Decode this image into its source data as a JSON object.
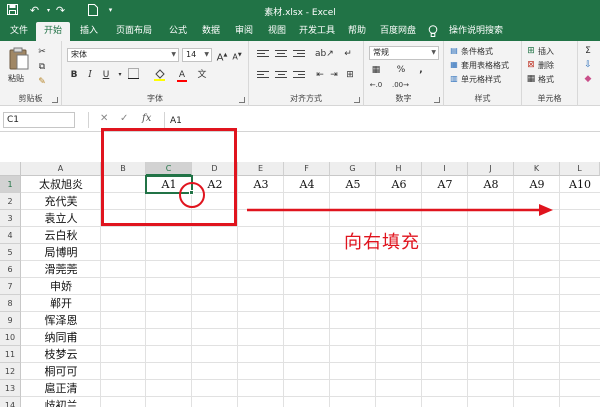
{
  "window": {
    "title": "素材.xlsx - Excel"
  },
  "qat": {
    "icons": [
      "save-icon",
      "undo-icon",
      "redo-icon",
      "new-document-icon",
      "customize-icon"
    ]
  },
  "tabs": [
    {
      "label": "文件"
    },
    {
      "label": "开始"
    },
    {
      "label": "插入"
    },
    {
      "label": "页面布局"
    },
    {
      "label": "公式"
    },
    {
      "label": "数据"
    },
    {
      "label": "审阅"
    },
    {
      "label": "视图"
    },
    {
      "label": "开发工具"
    },
    {
      "label": "帮助"
    },
    {
      "label": "百度网盘"
    },
    {
      "label": "操作说明搜索"
    }
  ],
  "active_tab": "开始",
  "ribbon": {
    "clipboard": {
      "paste_label": "粘贴",
      "group_label": "剪贴板"
    },
    "font": {
      "font_name": "宋体",
      "font_size": "14",
      "group_label": "字体"
    },
    "alignment": {
      "group_label": "对齐方式"
    },
    "number": {
      "format": "常规",
      "percent": "%",
      "comma": ",",
      "group_label": "数字"
    },
    "styles": {
      "conditional": "条件格式",
      "table": "套用表格格式",
      "cell_styles": "单元格样式",
      "group_label": "样式"
    },
    "cells": {
      "insert": "插入",
      "delete": "删除",
      "format": "格式",
      "group_label": "单元格"
    }
  },
  "formula_bar": {
    "name_box": "C1",
    "formula": "A1",
    "fx": "fx"
  },
  "sheet": {
    "columns": [
      "A",
      "B",
      "C",
      "D",
      "E",
      "F",
      "G",
      "H",
      "I",
      "J",
      "K",
      "L"
    ],
    "rows": [
      "1",
      "2",
      "3",
      "4",
      "5",
      "6",
      "7",
      "8",
      "9",
      "10",
      "11",
      "12",
      "13",
      "14"
    ],
    "col_a": [
      "太叔旭炎",
      "充代芙",
      "袁立人",
      "云白秋",
      "局博明",
      "滑莞莞",
      "申娇",
      "郸开",
      "恽泽恩",
      "纳同甫",
      "枝梦云",
      "桐可可",
      "扈正清",
      "歧初兰"
    ],
    "row1": [
      "A1",
      "A2",
      "A3",
      "A4",
      "A5",
      "A6",
      "A7",
      "A8",
      "A9",
      "A10"
    ],
    "active_cell": "C1"
  },
  "annotation": {
    "text": "向右填充",
    "color": "#e0141e"
  },
  "colors": {
    "excel_green": "#217346",
    "ribbon_bg": "#f3f3f3"
  }
}
